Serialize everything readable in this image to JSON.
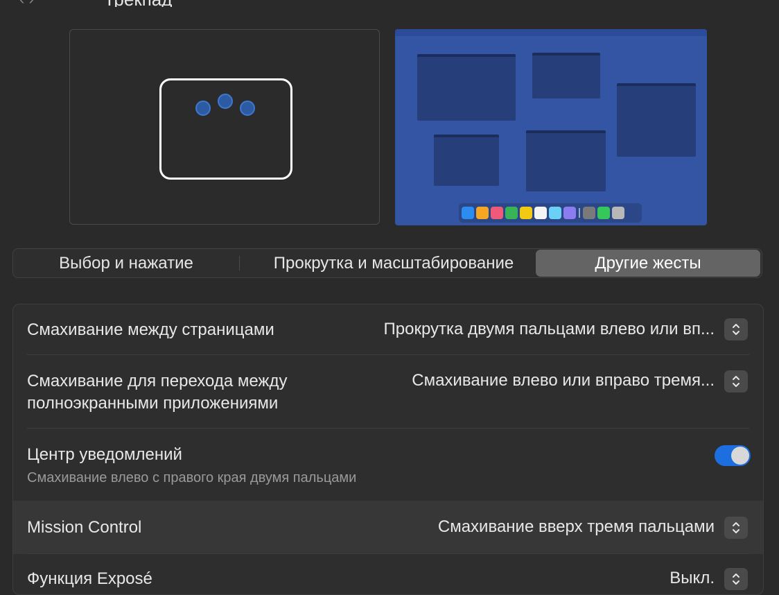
{
  "header": {
    "title": "Трекпад"
  },
  "tabs": [
    {
      "label": "Выбор и нажатие",
      "selected": false
    },
    {
      "label": "Прокрутка и масштабирование",
      "selected": false
    },
    {
      "label": "Другие жесты",
      "selected": true
    }
  ],
  "settings": [
    {
      "label": "Смахивание между страницами",
      "value": "Прокрутка двумя пальцами влево или вп..."
    },
    {
      "label": "Смахивание для перехода между полноэкранными приложениями",
      "label_line1": "Смахивание для перехода между",
      "label_line2": "полноэкранными приложениями",
      "value": "Смахивание влево или вправо тремя..."
    },
    {
      "label": "Центр уведомлений",
      "sublabel": "Смахивание влево с правого края двумя пальцами",
      "toggle": true
    },
    {
      "label": "Mission Control",
      "value": "Смахивание вверх тремя пальцами"
    },
    {
      "label": "Функция Exposé",
      "value": "Выкл."
    }
  ],
  "colors": {
    "accent": "#1d6fe0",
    "background": "#2a2a2a",
    "preview_desktop": "#3355a3"
  },
  "icons": {
    "stepper": "up-down-chevron-icon",
    "nav_back": "chevron-left-icon",
    "nav_forward": "chevron-right-icon"
  }
}
